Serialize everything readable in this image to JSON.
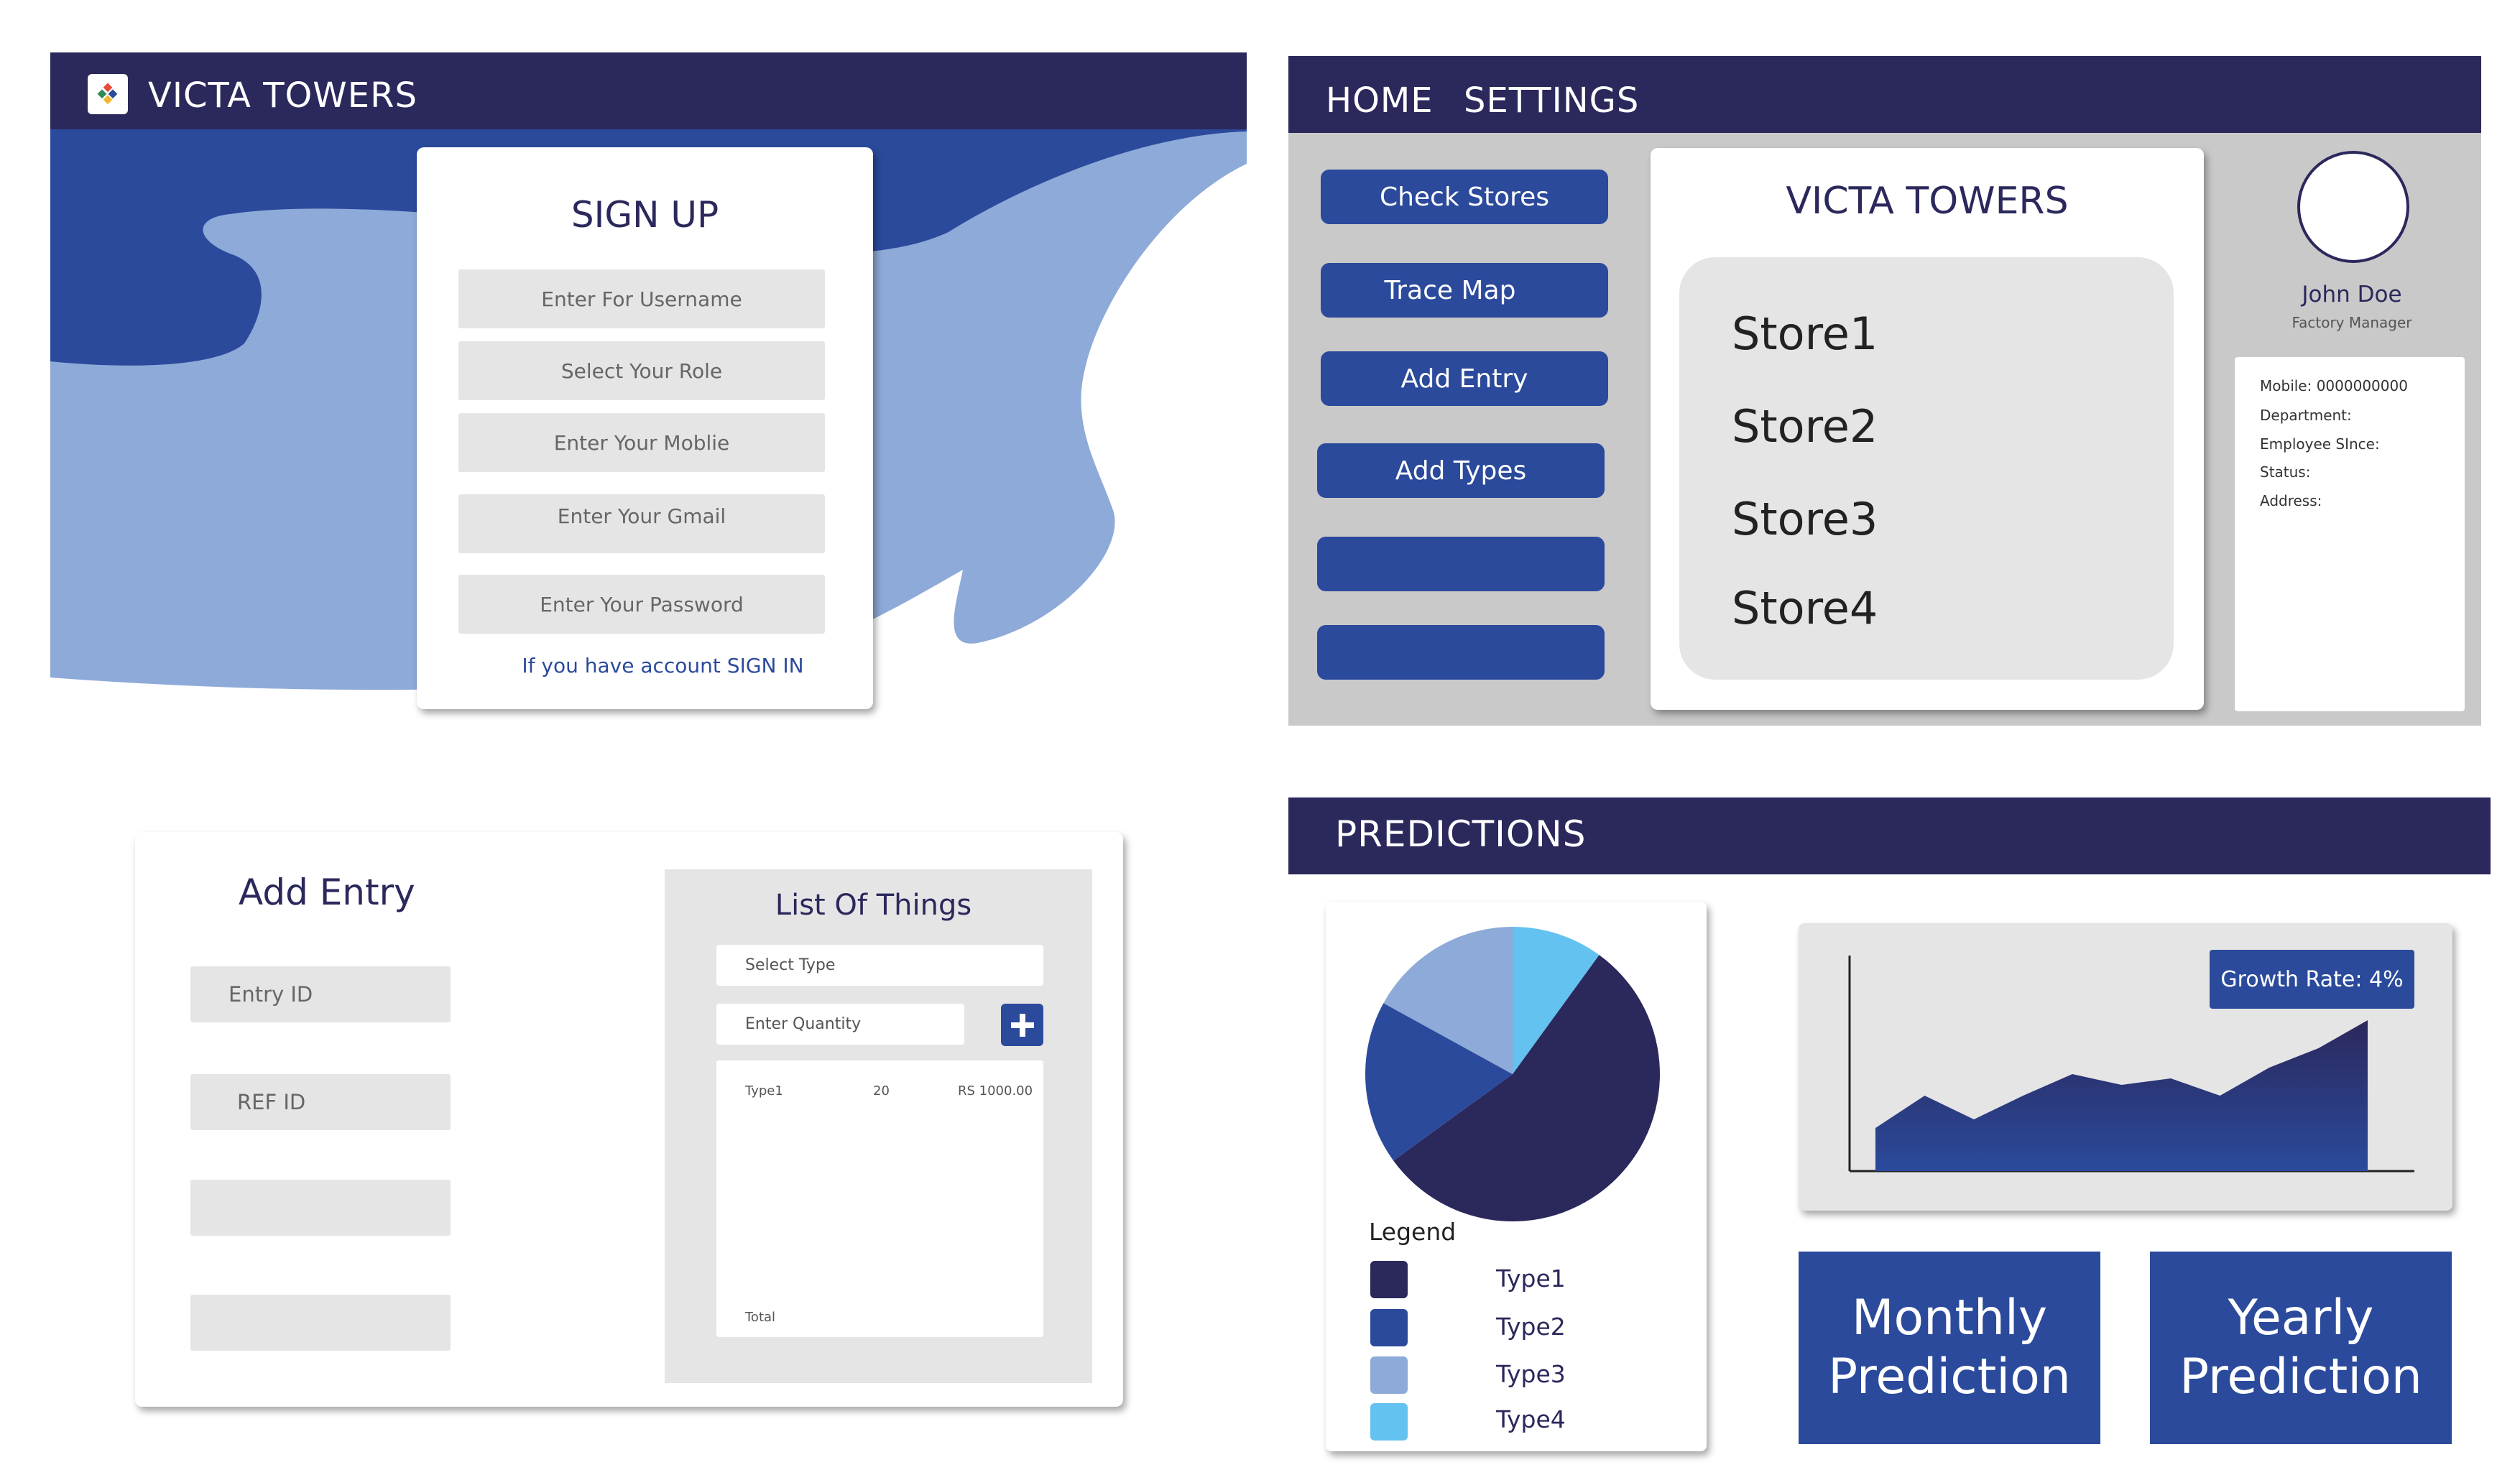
{
  "colors": {
    "navy": "#2b285c",
    "blue": "#2b4a9c",
    "light_blue": "#8eaad8",
    "sky": "#63c2ef",
    "gray": "#e5e5e5"
  },
  "signup": {
    "brand": "VICTA TOWERS",
    "title": "SIGN UP",
    "fields": [
      "Enter For Username",
      "Select Your Role",
      "Enter Your Moblie",
      "Enter Your Gmail",
      "Enter Your Password"
    ],
    "signin_link": "If you have account SIGN IN"
  },
  "home": {
    "nav": [
      "HOME",
      "SETTINGS"
    ],
    "buttons": [
      "Check Stores",
      "Trace Map",
      "Add Entry",
      "Add Types",
      "",
      ""
    ],
    "title": "VICTA TOWERS",
    "stores": [
      "Store1",
      "Store2",
      "Store3",
      "Store4"
    ],
    "profile": {
      "name": "John Doe",
      "role": "Factory Manager",
      "details": [
        "Mobile: 0000000000",
        "Department:",
        "Employee SInce:",
        "Status:",
        "Address:"
      ]
    }
  },
  "add_entry": {
    "title": "Add Entry",
    "fields": [
      "Entry ID",
      "REF ID",
      "",
      ""
    ],
    "list_title": "List Of Things",
    "select_placeholder": "Select Type",
    "quantity_placeholder": "Enter Quantity",
    "row": {
      "type": "Type1",
      "qty": "20",
      "price": "RS 1000.00"
    },
    "total_label": "Total"
  },
  "predictions": {
    "header": "PREDICTIONS",
    "legend_title": "Legend",
    "legend": [
      {
        "name": "Type1",
        "color": "#2b285c"
      },
      {
        "name": "Type2",
        "color": "#2b4a9c"
      },
      {
        "name": "Type3",
        "color": "#8eaad8"
      },
      {
        "name": "Type4",
        "color": "#63c2ef"
      }
    ],
    "growth_label": "Growth Rate: 4%",
    "monthly_label_1": "Monthly",
    "monthly_label_2": "Prediction",
    "yearly_label_1": "Yearly",
    "yearly_label_2": "Prediction"
  },
  "chart_data": [
    {
      "type": "pie",
      "title": "",
      "categories": [
        "Type1",
        "Type2",
        "Type3",
        "Type4"
      ],
      "values": [
        55,
        18,
        17,
        10
      ]
    },
    {
      "type": "area",
      "title": "",
      "xlabel": "",
      "ylabel": "",
      "x": [
        1,
        2,
        3,
        4,
        5,
        6,
        7,
        8,
        9,
        10,
        11
      ],
      "values": [
        20,
        35,
        24,
        35,
        45,
        40,
        43,
        35,
        48,
        57,
        70
      ],
      "ylim": [
        0,
        100
      ],
      "grid": false
    }
  ]
}
